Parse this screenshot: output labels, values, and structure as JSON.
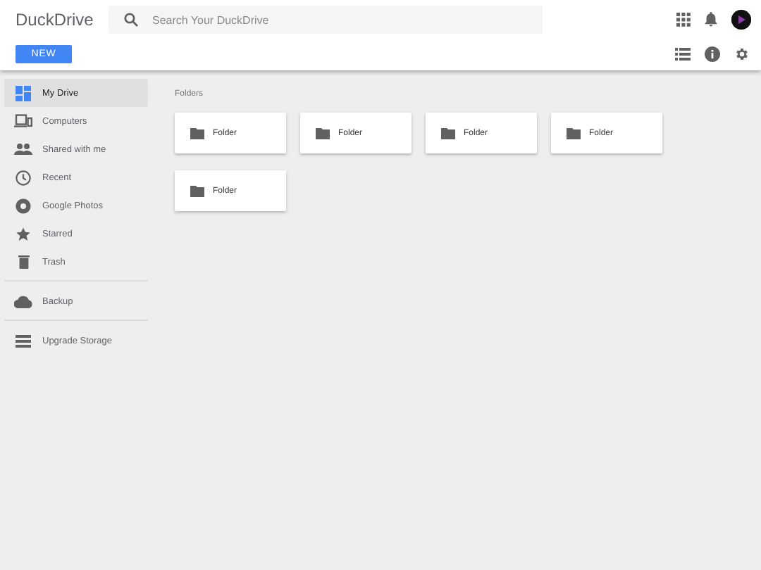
{
  "app": {
    "title": "DuckDrive"
  },
  "search": {
    "placeholder": "Search Your DuckDrive"
  },
  "new_button": {
    "label": "NEW"
  },
  "sidebar": {
    "groups": [
      [
        {
          "label": "My Drive",
          "selected": true
        },
        {
          "label": "Computers",
          "selected": false
        },
        {
          "label": "Shared with me",
          "selected": false
        },
        {
          "label": "Recent",
          "selected": false
        },
        {
          "label": "Google Photos",
          "selected": false
        },
        {
          "label": "Starred",
          "selected": false
        },
        {
          "label": "Trash",
          "selected": false
        }
      ],
      [
        {
          "label": "Backup",
          "selected": false
        }
      ],
      [
        {
          "label": "Upgrade Storage",
          "selected": false
        }
      ]
    ]
  },
  "main": {
    "heading": "Folders",
    "folders": [
      {
        "name": "Folder"
      },
      {
        "name": "Folder"
      },
      {
        "name": "Folder"
      },
      {
        "name": "Folder"
      },
      {
        "name": "Folder"
      }
    ]
  }
}
